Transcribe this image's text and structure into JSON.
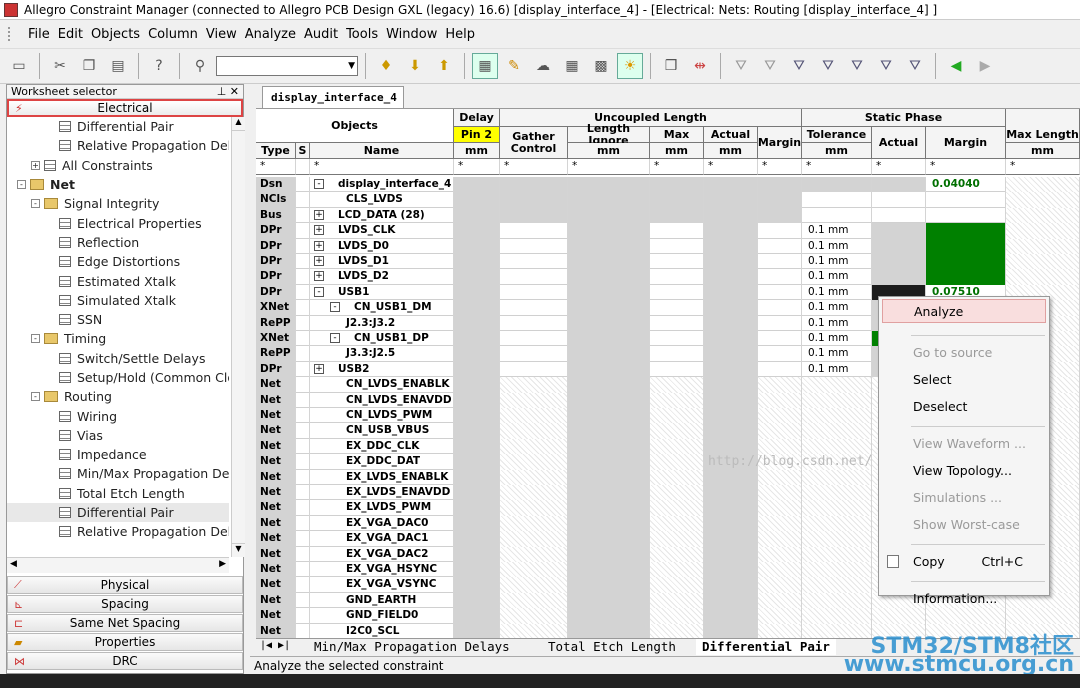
{
  "window": {
    "title": "Allegro Constraint Manager (connected to Allegro PCB Design GXL (legacy) 16.6) [display_interface_4] - [Electrical:  Nets:  Routing [display_interface_4] ]"
  },
  "menu": [
    "File",
    "Edit",
    "Objects",
    "Column",
    "View",
    "Analyze",
    "Audit",
    "Tools",
    "Window",
    "Help"
  ],
  "toolbar": {
    "icons": [
      "print-icon",
      "cut-icon",
      "copy-icon",
      "paste-icon",
      "help-icon",
      "filter-icon",
      "bulb-icon",
      "bulb-down-icon",
      "bulb-up-icon",
      "sheet-icon",
      "edit-icon",
      "cloud-icon",
      "table-icon",
      "table2-icon",
      "sun-icon",
      "box-icon",
      "route-icon",
      "funnel-icon",
      "funnel2-icon",
      "funnel3-icon",
      "funnel4-icon",
      "funnel5-icon",
      "funnel6-icon",
      "funnel7-icon",
      "back-arrow-icon",
      "forward-arrow-icon"
    ]
  },
  "worksheet": {
    "title": "Worksheet selector",
    "top_category": "Electrical",
    "tree": [
      {
        "label": "Differential Pair",
        "level": 3,
        "kind": "sheet"
      },
      {
        "label": "Relative Propagation Delay",
        "level": 3,
        "kind": "sheet"
      },
      {
        "label": "All Constraints",
        "level": 1,
        "kind": "sheet",
        "pm": "+"
      },
      {
        "label": "Net",
        "level": 0,
        "kind": "folder",
        "pm": "−",
        "bold": true
      },
      {
        "label": "Signal Integrity",
        "level": 1,
        "kind": "folder",
        "pm": "−"
      },
      {
        "label": "Electrical Properties",
        "level": 3,
        "kind": "sheet"
      },
      {
        "label": "Reflection",
        "level": 3,
        "kind": "sheet"
      },
      {
        "label": "Edge Distortions",
        "level": 3,
        "kind": "sheet"
      },
      {
        "label": "Estimated Xtalk",
        "level": 3,
        "kind": "sheet"
      },
      {
        "label": "Simulated Xtalk",
        "level": 3,
        "kind": "sheet"
      },
      {
        "label": "SSN",
        "level": 3,
        "kind": "sheet"
      },
      {
        "label": "Timing",
        "level": 1,
        "kind": "folder",
        "pm": "−"
      },
      {
        "label": "Switch/Settle Delays",
        "level": 3,
        "kind": "sheet"
      },
      {
        "label": "Setup/Hold (Common Clock)",
        "level": 3,
        "kind": "sheet"
      },
      {
        "label": "Routing",
        "level": 1,
        "kind": "folder",
        "pm": "−"
      },
      {
        "label": "Wiring",
        "level": 3,
        "kind": "sheet"
      },
      {
        "label": "Vias",
        "level": 3,
        "kind": "sheet"
      },
      {
        "label": "Impedance",
        "level": 3,
        "kind": "sheet"
      },
      {
        "label": "Min/Max Propagation Delays",
        "level": 3,
        "kind": "sheet"
      },
      {
        "label": "Total Etch Length",
        "level": 3,
        "kind": "sheet"
      },
      {
        "label": "Differential Pair",
        "level": 3,
        "kind": "sheet",
        "selected": true
      },
      {
        "label": "Relative Propagation Delay",
        "level": 3,
        "kind": "sheet"
      }
    ],
    "bottom_categories": [
      "Physical",
      "Spacing",
      "Same Net Spacing",
      "Properties",
      "DRC"
    ]
  },
  "grid": {
    "tab": "display_interface_4",
    "headers": {
      "objects": "Objects",
      "type": "Type",
      "s": "S",
      "name": "Name",
      "delay": "Delay",
      "pin2": "Pin 2",
      "mm": "mm",
      "uncoupled": "Uncoupled Length",
      "gather": "Gather Control",
      "len_ignore": "Length Ignore",
      "max": "Max",
      "actual": "Actual",
      "margin": "Margin",
      "static_phase": "Static Phase",
      "tolerance": "Tolerance",
      "sp_actual": "Actual",
      "sp_margin": "Margin",
      "max_length": "Max Length",
      "star": "*"
    },
    "rows": [
      {
        "type": "Dsn",
        "indent": 0,
        "pm": "−",
        "name": "display_interface_4",
        "tol": "",
        "margin": "0.04040",
        "style": "dsn"
      },
      {
        "type": "NCls",
        "indent": 1,
        "pm": "",
        "name": "CLS_LVDS",
        "tol": "",
        "margin": "",
        "style": "ncls"
      },
      {
        "type": "Bus",
        "indent": 0,
        "pm": "+",
        "name": "LCD_DATA (28)",
        "tol": "",
        "margin": "",
        "style": "bus"
      },
      {
        "type": "DPr",
        "indent": 0,
        "pm": "+",
        "name": "LVDS_CLK",
        "tol": "0.1 mm",
        "margin": "",
        "style": "dpr-green"
      },
      {
        "type": "DPr",
        "indent": 0,
        "pm": "+",
        "name": "LVDS_D0",
        "tol": "0.1 mm",
        "margin": "",
        "style": "dpr-green"
      },
      {
        "type": "DPr",
        "indent": 0,
        "pm": "+",
        "name": "LVDS_D1",
        "tol": "0.1 mm",
        "margin": "",
        "style": "dpr-green"
      },
      {
        "type": "DPr",
        "indent": 0,
        "pm": "+",
        "name": "LVDS_D2",
        "tol": "0.1 mm",
        "margin": "",
        "style": "dpr-green"
      },
      {
        "type": "DPr",
        "indent": 0,
        "pm": "−",
        "name": "USB1",
        "tol": "0.1 mm",
        "margin": "0.07510",
        "style": "usb1"
      },
      {
        "type": "XNet",
        "indent": 1,
        "pm": "−",
        "name": "CN_USB1_DM",
        "tol": "0.1 mm",
        "margin": "",
        "style": "xnet"
      },
      {
        "type": "RePP",
        "indent": 2,
        "pm": "",
        "name": "J2.3:J3.2",
        "tol": "0.1 mm",
        "margin": "",
        "style": "repp"
      },
      {
        "type": "XNet",
        "indent": 1,
        "pm": "−",
        "name": "CN_USB1_DP",
        "tol": "0.1 mm",
        "margin": "",
        "style": "xnet"
      },
      {
        "type": "RePP",
        "indent": 2,
        "pm": "",
        "name": "J3.3:J2.5",
        "tol": "0.1 mm",
        "margin": "",
        "style": "repp"
      },
      {
        "type": "DPr",
        "indent": 0,
        "pm": "+",
        "name": "USB2",
        "tol": "0.1 mm",
        "margin": "",
        "style": "dpr"
      },
      {
        "type": "Net",
        "indent": 1,
        "pm": "",
        "name": "CN_LVDS_ENABLK",
        "tol": "",
        "margin": "",
        "style": "net"
      },
      {
        "type": "Net",
        "indent": 1,
        "pm": "",
        "name": "CN_LVDS_ENAVDD",
        "tol": "",
        "margin": "",
        "style": "net"
      },
      {
        "type": "Net",
        "indent": 1,
        "pm": "",
        "name": "CN_LVDS_PWM",
        "tol": "",
        "margin": "",
        "style": "net"
      },
      {
        "type": "Net",
        "indent": 1,
        "pm": "",
        "name": "CN_USB_VBUS",
        "tol": "",
        "margin": "",
        "style": "net"
      },
      {
        "type": "Net",
        "indent": 1,
        "pm": "",
        "name": "EX_DDC_CLK",
        "tol": "",
        "margin": "",
        "style": "net"
      },
      {
        "type": "Net",
        "indent": 1,
        "pm": "",
        "name": "EX_DDC_DAT",
        "tol": "",
        "margin": "",
        "style": "net"
      },
      {
        "type": "Net",
        "indent": 1,
        "pm": "",
        "name": "EX_LVDS_ENABLK",
        "tol": "",
        "margin": "",
        "style": "net"
      },
      {
        "type": "Net",
        "indent": 1,
        "pm": "",
        "name": "EX_LVDS_ENAVDD",
        "tol": "",
        "margin": "",
        "style": "net"
      },
      {
        "type": "Net",
        "indent": 1,
        "pm": "",
        "name": "EX_LVDS_PWM",
        "tol": "",
        "margin": "",
        "style": "net"
      },
      {
        "type": "Net",
        "indent": 1,
        "pm": "",
        "name": "EX_VGA_DAC0",
        "tol": "",
        "margin": "",
        "style": "net"
      },
      {
        "type": "Net",
        "indent": 1,
        "pm": "",
        "name": "EX_VGA_DAC1",
        "tol": "",
        "margin": "",
        "style": "net"
      },
      {
        "type": "Net",
        "indent": 1,
        "pm": "",
        "name": "EX_VGA_DAC2",
        "tol": "",
        "margin": "",
        "style": "net"
      },
      {
        "type": "Net",
        "indent": 1,
        "pm": "",
        "name": "EX_VGA_HSYNC",
        "tol": "",
        "margin": "",
        "style": "net"
      },
      {
        "type": "Net",
        "indent": 1,
        "pm": "",
        "name": "EX_VGA_VSYNC",
        "tol": "",
        "margin": "",
        "style": "net"
      },
      {
        "type": "Net",
        "indent": 1,
        "pm": "",
        "name": "GND_EARTH",
        "tol": "",
        "margin": "",
        "style": "net"
      },
      {
        "type": "Net",
        "indent": 1,
        "pm": "",
        "name": "GND_FIELD0",
        "tol": "",
        "margin": "",
        "style": "net"
      },
      {
        "type": "Net",
        "indent": 1,
        "pm": "",
        "name": "I2C0_SCL",
        "tol": "",
        "margin": "",
        "style": "net"
      }
    ]
  },
  "sheet_tabs": [
    "Min/Max Propagation Delays",
    "Total Etch Length",
    "Differential Pair"
  ],
  "context_menu": {
    "items": [
      {
        "label": "Analyze",
        "enabled": true,
        "hot": true
      },
      {
        "sep": true
      },
      {
        "label": "Go to source",
        "enabled": false
      },
      {
        "label": "Select",
        "enabled": true
      },
      {
        "label": "Deselect",
        "enabled": true
      },
      {
        "sep": true
      },
      {
        "label": "View Waveform ...",
        "enabled": false
      },
      {
        "label": "View Topology...",
        "enabled": true
      },
      {
        "label": "Simulations ...",
        "enabled": false
      },
      {
        "label": "Show Worst-case",
        "enabled": false
      },
      {
        "sep": true
      },
      {
        "label": "Copy",
        "enabled": true,
        "accel": "Ctrl+C",
        "icon": "copy-icon"
      },
      {
        "sep": true
      },
      {
        "label": "Information...",
        "enabled": true
      }
    ]
  },
  "status": "Analyze the selected constraint",
  "watermarks": {
    "blog": "http://blog.csdn.net/",
    "brand1": "STM32/STM8社区",
    "brand2": "www.stmcu.org.cn"
  },
  "colors": {
    "pass_green": "#008000",
    "pin_yellow": "#ffff00",
    "selected_border": "#dd4444"
  }
}
